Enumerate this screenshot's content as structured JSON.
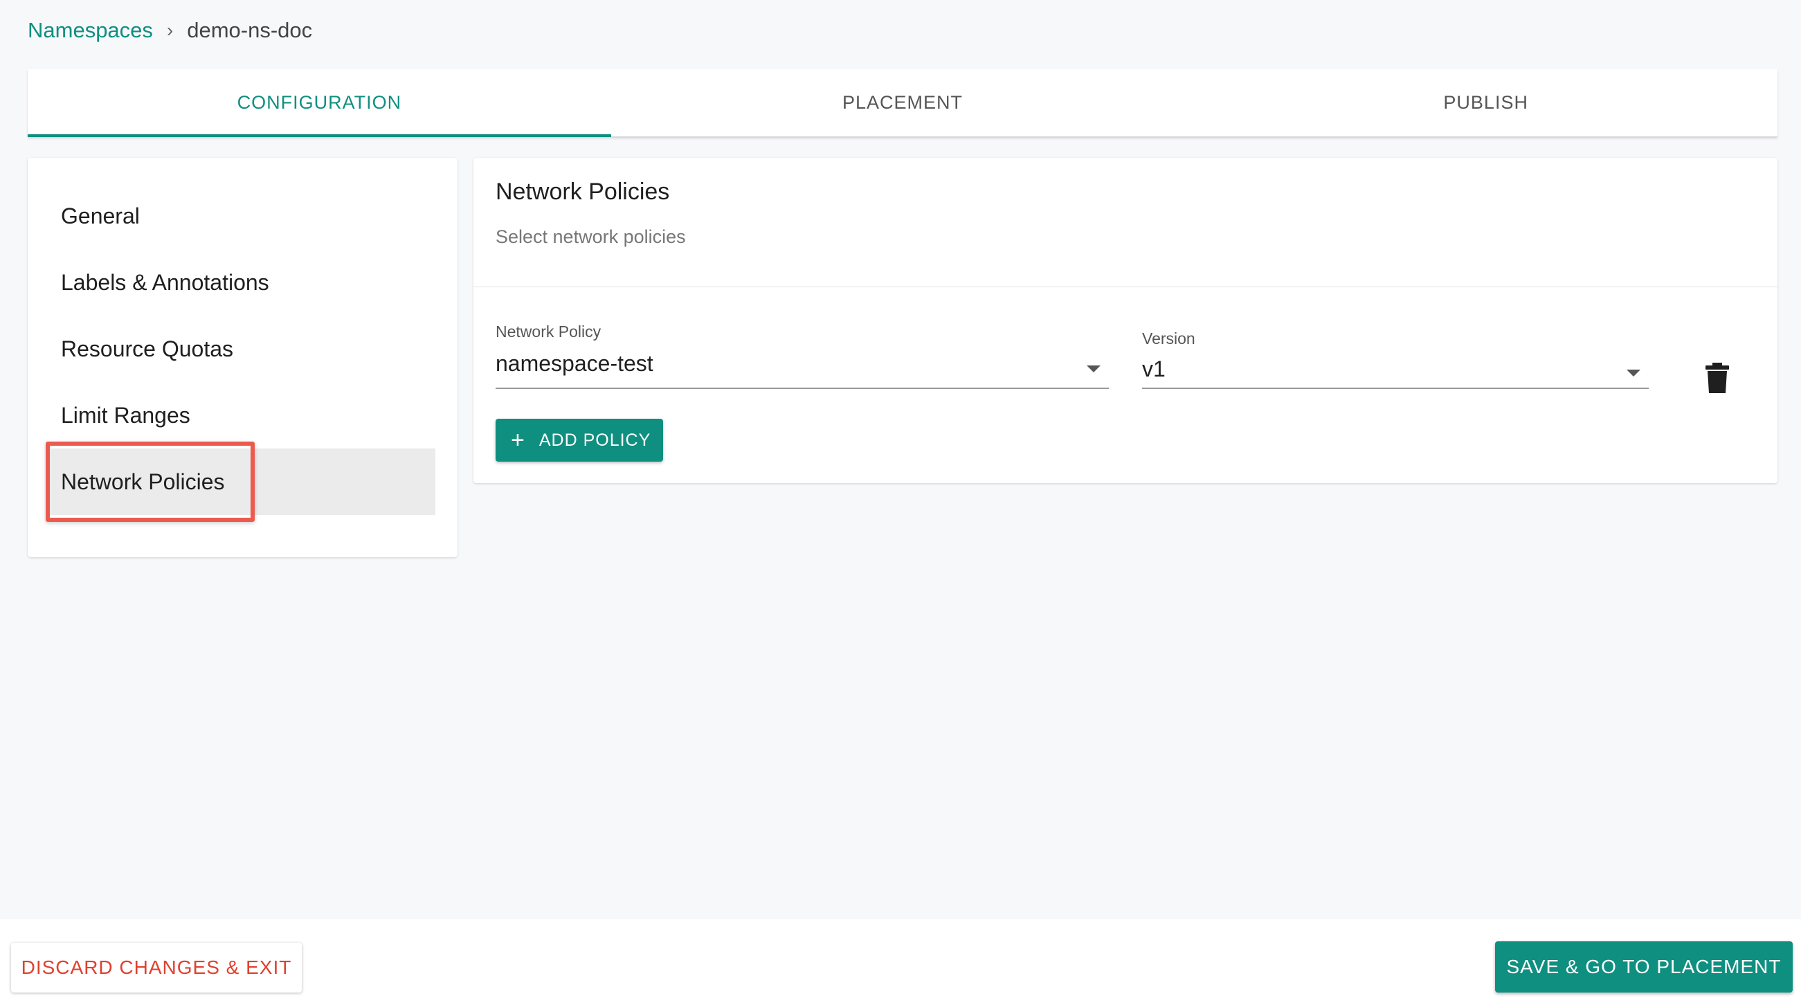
{
  "breadcrumb": {
    "root": "Namespaces",
    "separator": "›",
    "current": "demo-ns-doc"
  },
  "tabs": [
    {
      "label": "CONFIGURATION",
      "active": true
    },
    {
      "label": "PLACEMENT",
      "active": false
    },
    {
      "label": "PUBLISH",
      "active": false
    }
  ],
  "sidenav": {
    "items": [
      {
        "label": "General"
      },
      {
        "label": "Labels & Annotations"
      },
      {
        "label": "Resource Quotas"
      },
      {
        "label": "Limit Ranges"
      },
      {
        "label": "Network Policies",
        "active": true
      }
    ]
  },
  "section": {
    "title": "Network Policies",
    "subtitle": "Select network policies",
    "policy_field": {
      "label": "Network Policy",
      "value": "namespace-test"
    },
    "version_field": {
      "label": "Version",
      "value": "v1"
    },
    "add_button": {
      "icon": "plus-icon",
      "label": "ADD POLICY"
    },
    "delete_icon": "trash-icon"
  },
  "footer": {
    "discard_label": "DISCARD CHANGES & EXIT",
    "save_label": "SAVE & GO TO PLACEMENT"
  },
  "colors": {
    "accent": "#0f8f80",
    "danger": "#e0402e",
    "highlight": "#ec5a4e"
  }
}
